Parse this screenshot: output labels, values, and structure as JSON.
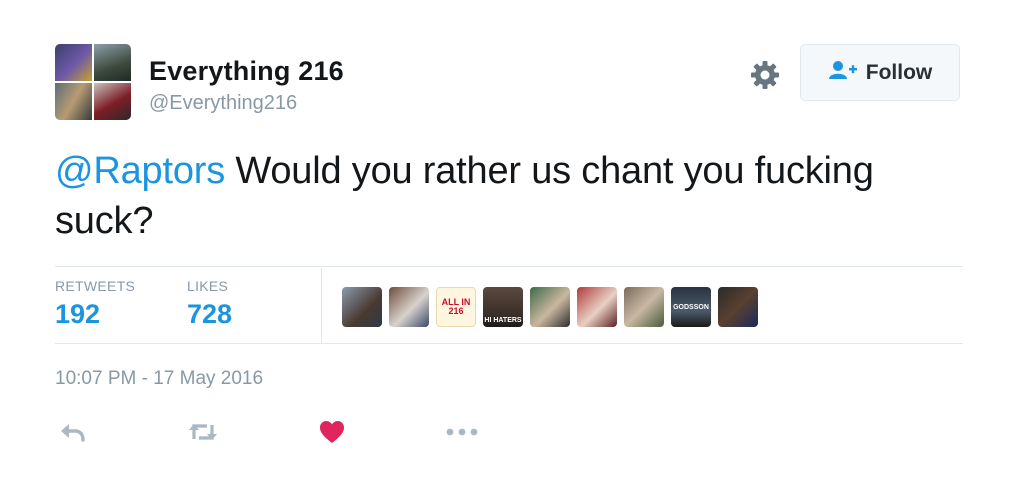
{
  "user": {
    "display_name": "Everything 216",
    "screen_name": "@Everything216"
  },
  "header": {
    "settings_icon": "gear-icon",
    "follow_icon": "follow-person-plus-icon",
    "follow_label": "Follow"
  },
  "tweet": {
    "mention": "@Raptors",
    "body": " Would you rather us chant you fucking suck?"
  },
  "stats": {
    "retweets_label": "RETWEETS",
    "retweets_value": "192",
    "likes_label": "LIKES",
    "likes_value": "728"
  },
  "likers": [
    {
      "name": "liker-avatar"
    },
    {
      "name": "liker-avatar"
    },
    {
      "name": "liker-avatar",
      "text": "ALL IN 216"
    },
    {
      "name": "liker-avatar",
      "text": "HI HATERS"
    },
    {
      "name": "liker-avatar"
    },
    {
      "name": "liker-avatar"
    },
    {
      "name": "liker-avatar"
    },
    {
      "name": "liker-avatar",
      "text": "GODSSON"
    },
    {
      "name": "liker-avatar"
    }
  ],
  "timestamp": "10:07 PM - 17 May 2016",
  "actions": [
    "reply-icon",
    "retweet-icon",
    "like-heart-icon",
    "more-dots-icon"
  ],
  "colors": {
    "link": "#1b95e0",
    "muted": "#8899a6",
    "text": "#14171a",
    "like": "#e0245e",
    "border": "#e1e8ed"
  }
}
